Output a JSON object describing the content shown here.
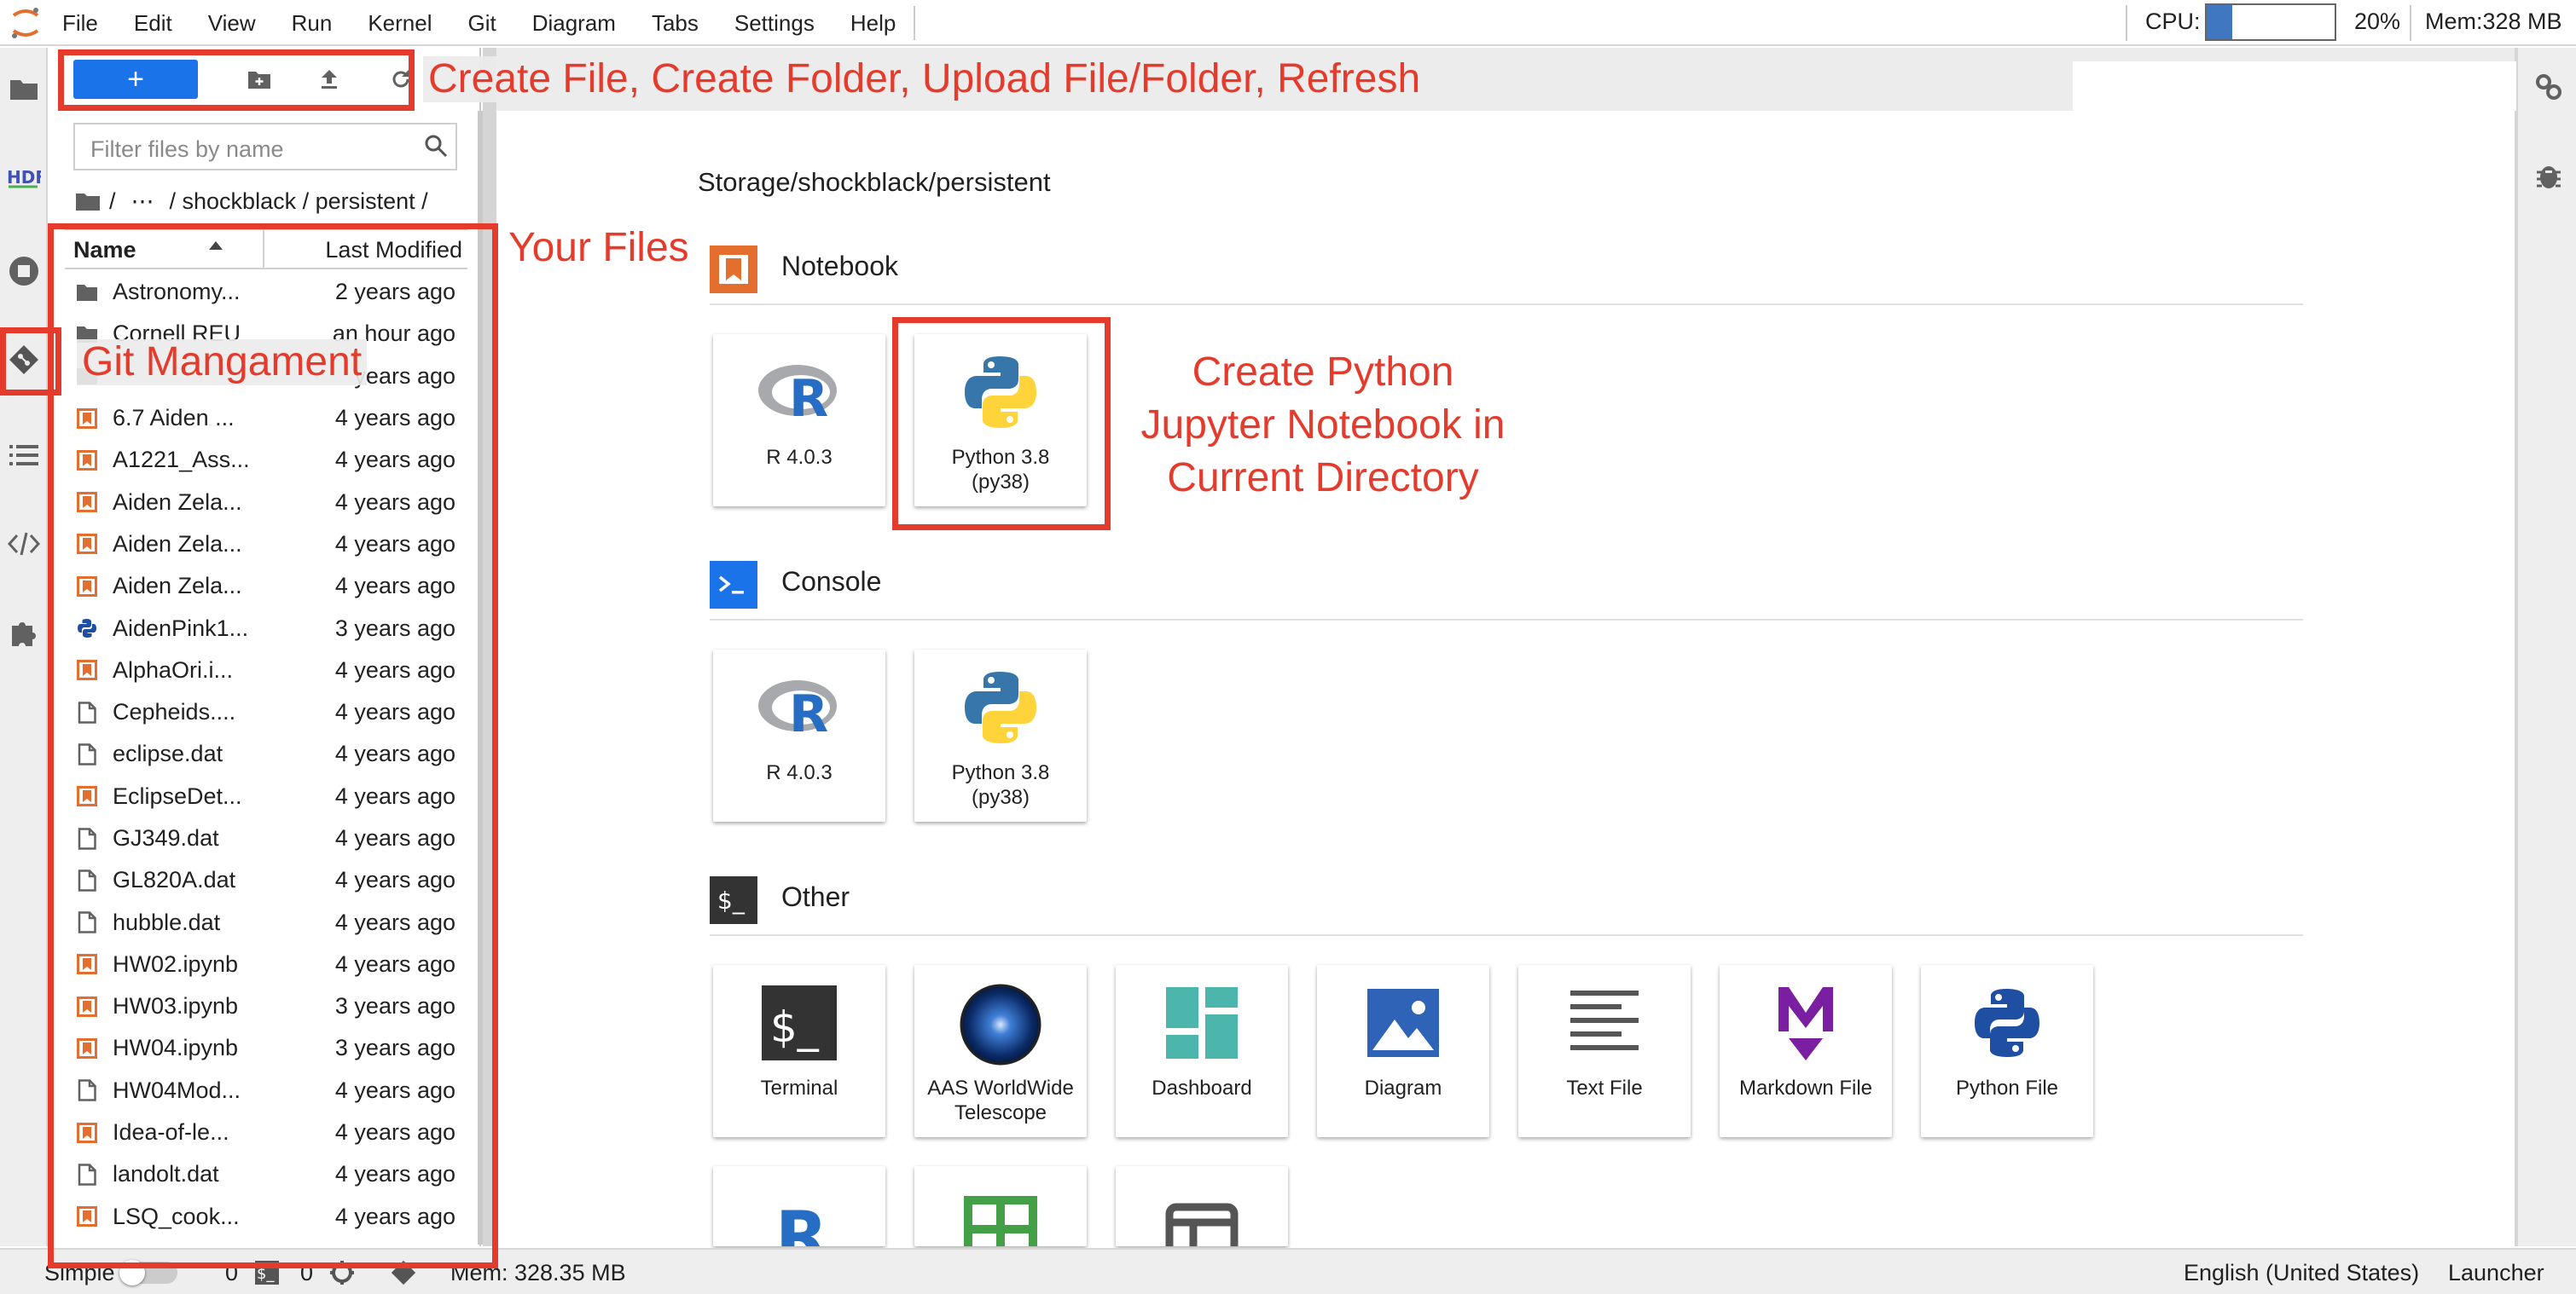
{
  "menubar": {
    "items": [
      "File",
      "Edit",
      "View",
      "Run",
      "Kernel",
      "Git",
      "Diagram",
      "Tabs",
      "Settings",
      "Help"
    ],
    "cpu_label": "CPU:",
    "cpu_percent": "20%",
    "cpu_level": 0.2,
    "mem_label": "Mem:328 MB"
  },
  "filebrowser": {
    "filter_placeholder": "Filter files by name",
    "breadcrumb": [
      "/",
      "⋯",
      "/ shockblack / persistent /"
    ],
    "col_name": "Name",
    "col_modified": "Last Modified",
    "files": [
      {
        "icon": "folder-icon",
        "name": "Astronomy...",
        "modified": "2 years ago"
      },
      {
        "icon": "folder-icon",
        "name": "Cornell REU",
        "modified": "an hour ago"
      },
      {
        "icon": "folder-icon",
        "name": "",
        "modified": "years ago"
      },
      {
        "icon": "notebook-icon",
        "name": "6.7 Aiden ...",
        "modified": "4 years ago"
      },
      {
        "icon": "notebook-icon",
        "name": "A1221_Ass...",
        "modified": "4 years ago"
      },
      {
        "icon": "notebook-icon",
        "name": "Aiden Zela...",
        "modified": "4 years ago"
      },
      {
        "icon": "notebook-icon",
        "name": "Aiden Zela...",
        "modified": "4 years ago"
      },
      {
        "icon": "notebook-icon",
        "name": "Aiden Zela...",
        "modified": "4 years ago"
      },
      {
        "icon": "python-file-icon",
        "name": "AidenPink1...",
        "modified": "3 years ago"
      },
      {
        "icon": "notebook-icon",
        "name": "AlphaOri.i...",
        "modified": "4 years ago"
      },
      {
        "icon": "file-icon",
        "name": "Cepheids....",
        "modified": "4 years ago"
      },
      {
        "icon": "file-icon",
        "name": "eclipse.dat",
        "modified": "4 years ago"
      },
      {
        "icon": "notebook-icon",
        "name": "EclipseDet...",
        "modified": "4 years ago"
      },
      {
        "icon": "file-icon",
        "name": "GJ349.dat",
        "modified": "4 years ago"
      },
      {
        "icon": "file-icon",
        "name": "GL820A.dat",
        "modified": "4 years ago"
      },
      {
        "icon": "file-icon",
        "name": "hubble.dat",
        "modified": "4 years ago"
      },
      {
        "icon": "notebook-icon",
        "name": "HW02.ipynb",
        "modified": "4 years ago"
      },
      {
        "icon": "notebook-icon",
        "name": "HW03.ipynb",
        "modified": "3 years ago"
      },
      {
        "icon": "notebook-icon",
        "name": "HW04.ipynb",
        "modified": "3 years ago"
      },
      {
        "icon": "file-icon",
        "name": "HW04Mod...",
        "modified": "4 years ago"
      },
      {
        "icon": "notebook-icon",
        "name": "Idea-of-le...",
        "modified": "4 years ago"
      },
      {
        "icon": "file-icon",
        "name": "landolt.dat",
        "modified": "4 years ago"
      },
      {
        "icon": "notebook-icon",
        "name": "LSQ_cook...",
        "modified": "4 years ago"
      }
    ]
  },
  "launcher": {
    "cwd": "Storage/shockblack/persistent",
    "sections": {
      "notebook": "Notebook",
      "console": "Console",
      "other": "Other"
    },
    "notebook_cards": [
      {
        "icon": "r-logo-icon",
        "label": "R 4.0.3"
      },
      {
        "icon": "python-logo-icon",
        "label": "Python 3.8\n(py38)"
      }
    ],
    "console_cards": [
      {
        "icon": "r-logo-icon",
        "label": "R 4.0.3"
      },
      {
        "icon": "python-logo-icon",
        "label": "Python 3.8\n(py38)"
      }
    ],
    "other_cards": [
      {
        "icon": "terminal-icon",
        "label": "Terminal"
      },
      {
        "icon": "worldwide-telescope-icon",
        "label": "AAS WorldWide\nTelescope"
      },
      {
        "icon": "dashboard-icon",
        "label": "Dashboard"
      },
      {
        "icon": "diagram-icon",
        "label": "Diagram"
      },
      {
        "icon": "text-file-icon",
        "label": "Text File"
      },
      {
        "icon": "markdown-icon",
        "label": "Markdown File"
      },
      {
        "icon": "python-file-icon",
        "label": "Python File"
      }
    ]
  },
  "statusbar": {
    "mode": "Simple",
    "terminals": "0",
    "kernels": "0",
    "mem": "Mem: 328.35 MB",
    "language": "English (United States)",
    "current": "Launcher"
  },
  "annotations": {
    "toolbar": "Create File, Create Folder, Upload File/Folder, Refresh",
    "files": "Your Files",
    "git": "Git Mangament",
    "notebook_line1": "Create Python",
    "notebook_line2": "Jupyter Notebook in",
    "notebook_line3": "Current Directory"
  },
  "colors": {
    "accent": "#1a73e8",
    "annotation": "#e53b2c",
    "notebook_orange": "#e46e2e"
  }
}
